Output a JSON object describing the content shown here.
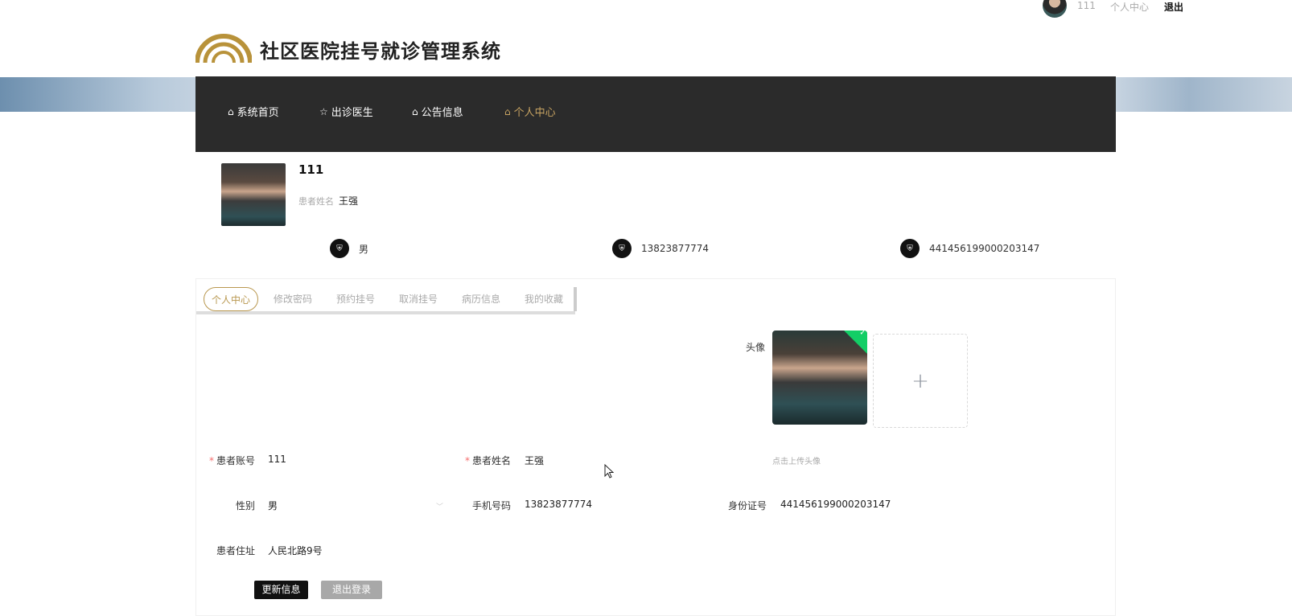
{
  "topbar": {
    "username": "111",
    "center_link": "个人中心",
    "logout": "退出"
  },
  "header": {
    "title": "社区医院挂号就诊管理系统",
    "brand_color": "#c8a462"
  },
  "nav": {
    "items": [
      {
        "label": "系统首页",
        "icon": "home-icon"
      },
      {
        "label": "出诊医生",
        "icon": "star-icon"
      },
      {
        "label": "公告信息",
        "icon": "bag-icon"
      },
      {
        "label": "个人中心",
        "icon": "home-icon",
        "active": true
      }
    ]
  },
  "profile": {
    "name": "111",
    "name_label": "患者姓名",
    "name_value": "王强",
    "info": [
      {
        "icon": "shield-icon",
        "value": "男"
      },
      {
        "icon": "shield-icon",
        "value": "13823877774"
      },
      {
        "icon": "shield-icon",
        "value": "441456199000203147"
      }
    ]
  },
  "tabs": [
    {
      "label": "个人中心",
      "active": true
    },
    {
      "label": "修改密码"
    },
    {
      "label": "预约挂号"
    },
    {
      "label": "取消挂号"
    },
    {
      "label": "病历信息"
    },
    {
      "label": "我的收藏"
    }
  ],
  "form": {
    "avatar_label": "头像",
    "upload_tip": "点击上传头像",
    "add_symbol": "+",
    "account_label": "患者账号",
    "account_value": "111",
    "name_label": "患者姓名",
    "name_value": "王强",
    "gender_label": "性别",
    "gender_value": "男",
    "phone_label": "手机号码",
    "phone_value": "13823877774",
    "id_label": "身份证号",
    "id_value": "441456199000203147",
    "address_label": "患者住址",
    "address_value": "人民北路9号",
    "update_button": "更新信息",
    "logout_button": "退出登录"
  }
}
